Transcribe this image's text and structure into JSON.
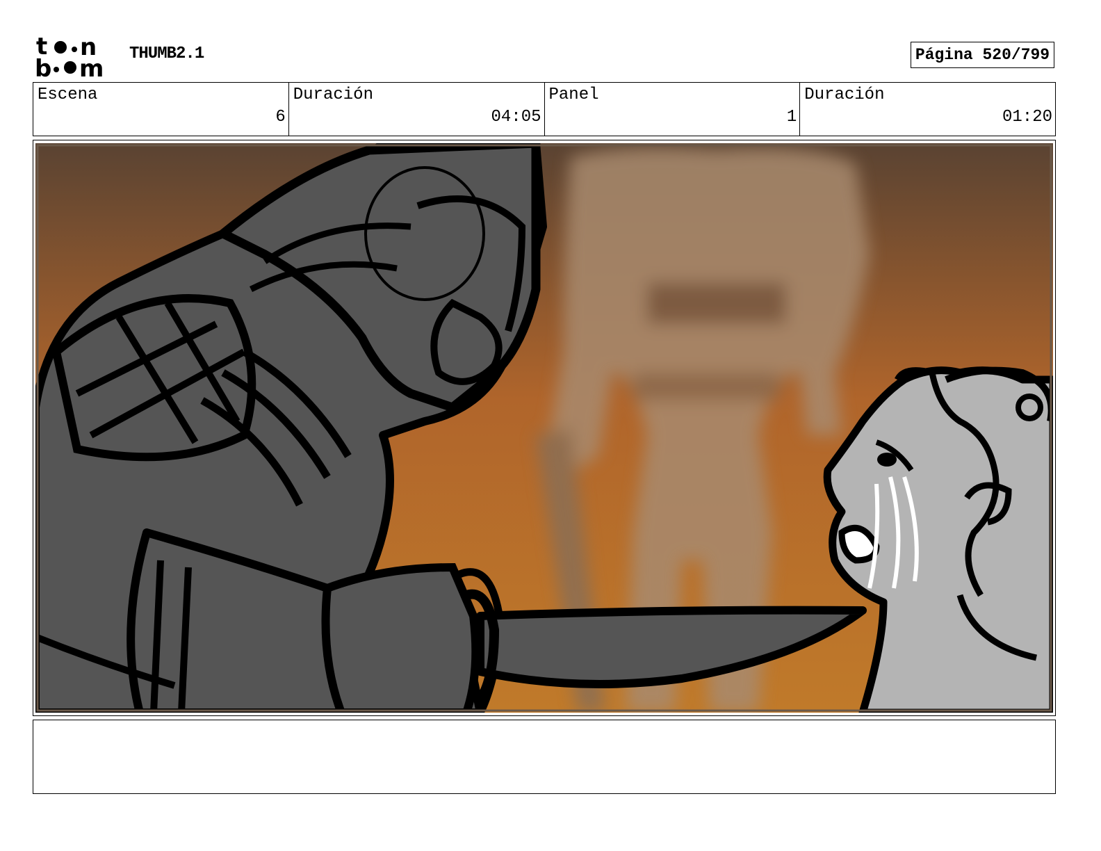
{
  "header": {
    "logo_text": "toon boom",
    "title": "THUMB2.1",
    "page_label": "Página 520/799"
  },
  "info": {
    "scene_label": "Escena",
    "scene_value": "6",
    "scene_duration_label": "Duración",
    "scene_duration_value": "04:05",
    "panel_label": "Panel",
    "panel_value": "1",
    "panel_duration_label": "Duración",
    "panel_duration_value": "01:20"
  },
  "notes": {
    "text": ""
  },
  "colors": {
    "sky_top": "#5a4332",
    "sky_mid": "#b0652b",
    "sky_bottom": "#c07a2a",
    "armor": "#555555",
    "face": "#b4b4b4",
    "ink": "#000000"
  }
}
